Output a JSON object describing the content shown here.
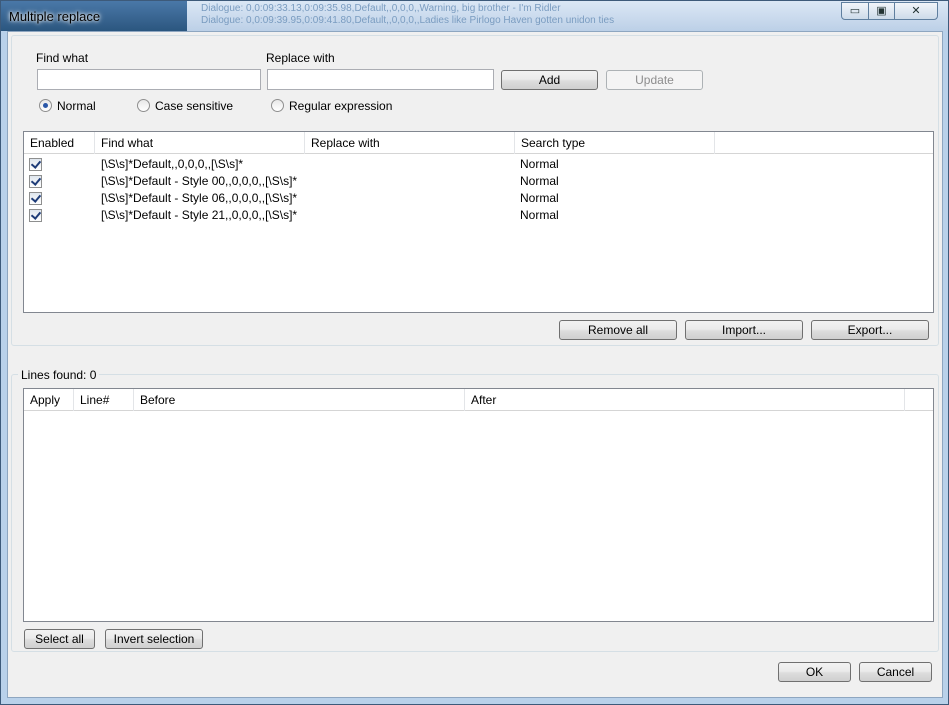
{
  "window": {
    "title": "Multiple replace",
    "background_text": [
      "Dialogue: 0,0:09:33.13,0:09:35.98,Default,,0,0,0,,Warning, big brother - I'm Ridler",
      "Dialogue: 0,0:09:39.95,0:09:41.80,Default,,0,0,0,,Ladies like Pirlogo Haven gotten unidon ties"
    ],
    "controls": {
      "minimize": "▭",
      "maximize": "▣",
      "close": "✕"
    }
  },
  "form": {
    "find_label": "Find what",
    "find_value": "",
    "replace_label": "Replace with",
    "replace_value": "",
    "add_label": "Add",
    "update_label": "Update",
    "radios": [
      {
        "label": "Normal",
        "selected": true
      },
      {
        "label": "Case sensitive",
        "selected": false
      },
      {
        "label": "Regular expression",
        "selected": false
      }
    ]
  },
  "rules_table": {
    "columns": [
      "Enabled",
      "Find what",
      "Replace with",
      "Search type"
    ],
    "rows": [
      {
        "enabled": true,
        "find": "[\\S\\s]*Default,,0,0,0,,[\\S\\s]*",
        "replace": "",
        "type": "Normal"
      },
      {
        "enabled": true,
        "find": "[\\S\\s]*Default - Style 00,,0,0,0,,[\\S\\s]*",
        "replace": "",
        "type": "Normal"
      },
      {
        "enabled": true,
        "find": "[\\S\\s]*Default - Style 06,,0,0,0,,[\\S\\s]*",
        "replace": "",
        "type": "Normal"
      },
      {
        "enabled": true,
        "find": "[\\S\\s]*Default - Style 21,,0,0,0,,[\\S\\s]*",
        "replace": "",
        "type": "Normal"
      }
    ]
  },
  "rules_buttons": {
    "remove_all": "Remove all",
    "import": "Import...",
    "export": "Export..."
  },
  "results": {
    "lines_found": "Lines found: 0",
    "columns": [
      "Apply",
      "Line#",
      "Before",
      "After"
    ],
    "select_all": "Select all",
    "invert_selection": "Invert selection"
  },
  "dialog": {
    "ok": "OK",
    "cancel": "Cancel"
  }
}
